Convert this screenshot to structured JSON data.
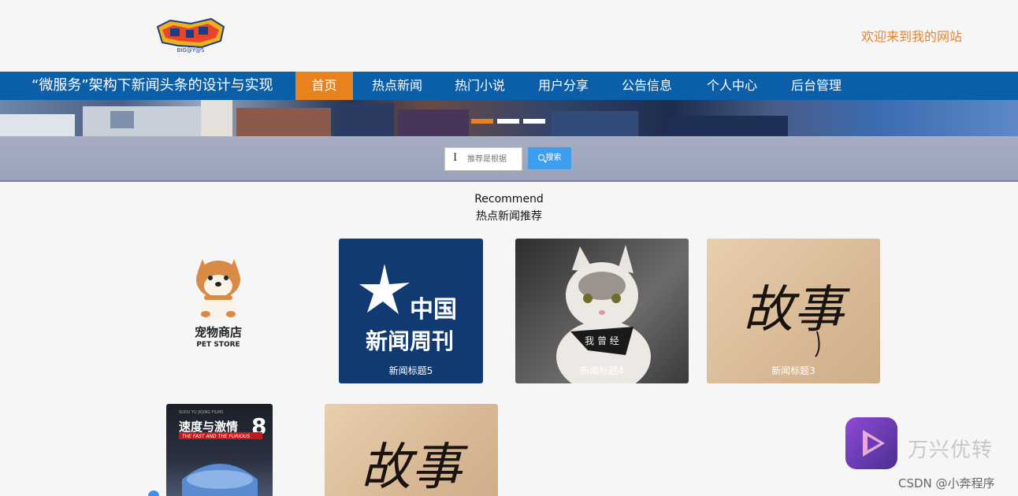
{
  "header": {
    "logo_text": "BIG@Y@S",
    "welcome": "欢迎来到我的网站"
  },
  "nav": {
    "site_title": "“微服务”架构下新闻头条的设计与实现",
    "items": [
      "首页",
      "热点新闻",
      "热门小说",
      "用户分享",
      "公告信息",
      "个人中心",
      "后台管理"
    ],
    "active_index": 0
  },
  "banner": {
    "slide_count": 3,
    "active_index": 0
  },
  "search": {
    "placeholder": "推荐是根据",
    "button_label": "搜索"
  },
  "section": {
    "title_en": "Recommend",
    "title_cn": "热点新闻推荐"
  },
  "cards": [
    {
      "logo_cn": "宠物商店",
      "logo_en": "PET STORE"
    },
    {
      "caption": "新闻标题5",
      "image_text_1": "中国",
      "image_text_2": "新闻周刊"
    },
    {
      "caption": "新闻标题4",
      "image_text": "我 曾 经"
    },
    {
      "caption": "新闻标题3",
      "image_text": "故事"
    },
    {
      "image_title": "速度与激情",
      "image_number": "8",
      "image_subtitle": "THE FAST AND THE FURIOUS",
      "image_top": "SUDU YU JIQING FILMS"
    },
    {
      "image_text": "故事"
    }
  ],
  "watermark": {
    "brand": "万兴优转",
    "csdn": "CSDN @小奔程序"
  },
  "colors": {
    "nav_bg": "#0b5fa8",
    "accent": "#e8821e",
    "search_btn": "#3d9ef0"
  }
}
